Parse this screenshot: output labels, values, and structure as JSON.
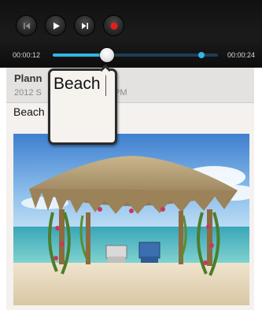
{
  "player": {
    "elapsed": "00:00:12",
    "total": "00:00:24",
    "progress_fraction": 0.33,
    "marker_fraction": 0.9,
    "controls": [
      {
        "name": "skip-previous-icon",
        "label": "skip previous"
      },
      {
        "name": "play-icon",
        "label": "play"
      },
      {
        "name": "skip-next-icon",
        "label": "skip next"
      },
      {
        "name": "record-icon",
        "label": "record"
      }
    ],
    "colors": {
      "accent": "#33b5e5",
      "record": "#e0201b"
    }
  },
  "note": {
    "title": "Plann",
    "date": "2012 S",
    "time_suffix": "PM",
    "body": "Beach"
  },
  "magnifier": {
    "text": "Beach"
  }
}
